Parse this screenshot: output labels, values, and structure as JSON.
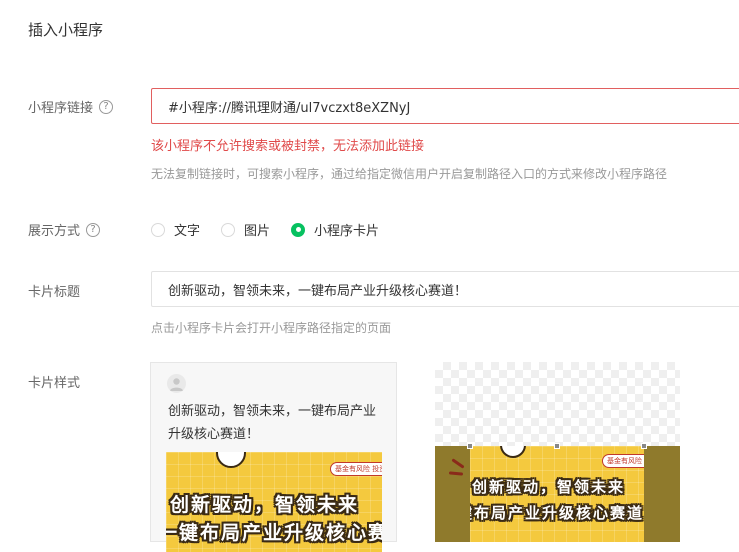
{
  "dialog": {
    "title": "插入小程序"
  },
  "link_row": {
    "label": "小程序链接",
    "help_glyph": "?",
    "input_value": "#小程序://腾讯理财通/ul7vczxt8eXZNyJ",
    "error": "该小程序不允许搜索或被封禁，无法添加此链接",
    "hint": "无法复制链接时，可搜索小程序，通过给指定微信用户开启复制路径入口的方式来修改小程序路径"
  },
  "display_row": {
    "label": "展示方式",
    "help_glyph": "?",
    "options": [
      {
        "label": "文字",
        "checked": false
      },
      {
        "label": "图片",
        "checked": false
      },
      {
        "label": "小程序卡片",
        "checked": true
      }
    ],
    "checked_color": "#07c160"
  },
  "card_title_row": {
    "label": "卡片标题",
    "input_value": "创新驱动，智领未来，一键布局产业升级核心赛道！",
    "hint": "点击小程序卡片会打开小程序路径指定的页面"
  },
  "card_style_row": {
    "label": "卡片样式",
    "preview_text": "创新驱动，智领未来，一键布局产业升级核心赛道！",
    "poster": {
      "badge": "基金有风险 投资需谨慎",
      "headline_1": "创新驱动，智领未来",
      "headline_2": "一键布局产业升级核心赛道"
    }
  },
  "colors": {
    "error": "#e04a4a",
    "accent": "#07c160",
    "poster_yellow": "#f4c93e"
  }
}
